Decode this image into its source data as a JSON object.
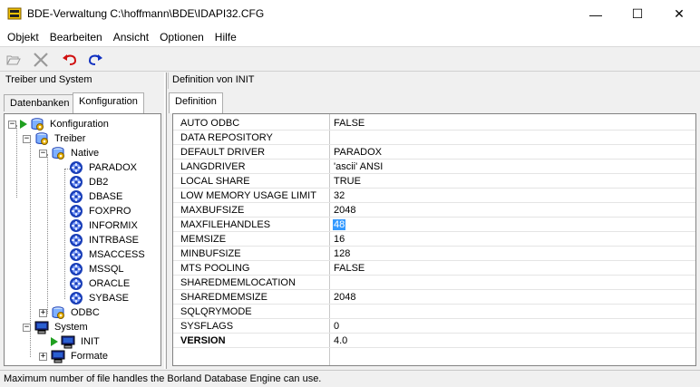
{
  "window": {
    "title": "BDE-Verwaltung  C:\\hoffmann\\BDE\\IDAPI32.CFG",
    "minimize_glyph": "—",
    "maximize_glyph": "☐",
    "close_glyph": "✕"
  },
  "menu": [
    {
      "label": "Objekt"
    },
    {
      "label": "Bearbeiten"
    },
    {
      "label": "Ansicht"
    },
    {
      "label": "Optionen"
    },
    {
      "label": "Hilfe"
    }
  ],
  "toolbar": {
    "icons": [
      "open-folder-icon",
      "delete-x-icon",
      "undo-icon",
      "redo-icon"
    ]
  },
  "left": {
    "header": "Treiber und System",
    "tabs": [
      "Datenbanken",
      "Konfiguration"
    ],
    "active_tab": "Konfiguration",
    "tree": [
      {
        "label": "Konfiguration",
        "exp": "−",
        "icon": "config-db-icon",
        "play": true
      },
      {
        "label": "Treiber",
        "exp": "−",
        "icon": "drivers-db-icon",
        "play": false
      },
      {
        "label": "Native",
        "exp": "−",
        "icon": "native-db-icon",
        "play": false
      },
      {
        "label": "PARADOX",
        "exp": "",
        "icon": "driver-icon",
        "play": false
      },
      {
        "label": "DB2",
        "exp": "",
        "icon": "driver-icon",
        "play": false
      },
      {
        "label": "DBASE",
        "exp": "",
        "icon": "driver-icon",
        "play": false
      },
      {
        "label": "FOXPRO",
        "exp": "",
        "icon": "driver-icon",
        "play": false
      },
      {
        "label": "INFORMIX",
        "exp": "",
        "icon": "driver-icon",
        "play": false
      },
      {
        "label": "INTRBASE",
        "exp": "",
        "icon": "driver-icon",
        "play": false
      },
      {
        "label": "MSACCESS",
        "exp": "",
        "icon": "driver-icon",
        "play": false
      },
      {
        "label": "MSSQL",
        "exp": "",
        "icon": "driver-icon",
        "play": false
      },
      {
        "label": "ORACLE",
        "exp": "",
        "icon": "driver-icon",
        "play": false
      },
      {
        "label": "SYBASE",
        "exp": "",
        "icon": "driver-icon",
        "play": false
      },
      {
        "label": "ODBC",
        "exp": "+",
        "icon": "odbc-db-icon",
        "play": false
      },
      {
        "label": "System",
        "exp": "−",
        "icon": "system-computer-icon",
        "play": false
      },
      {
        "label": "INIT",
        "exp": "",
        "icon": "init-computer-icon",
        "play": true
      },
      {
        "label": "Formate",
        "exp": "+",
        "icon": "formats-computer-icon",
        "play": false
      }
    ]
  },
  "right": {
    "header": "Definition von INIT",
    "tab": "Definition",
    "rows": [
      {
        "key": "AUTO ODBC",
        "value": "FALSE"
      },
      {
        "key": "DATA REPOSITORY",
        "value": ""
      },
      {
        "key": "DEFAULT DRIVER",
        "value": "PARADOX"
      },
      {
        "key": "LANGDRIVER",
        "value": "'ascii' ANSI"
      },
      {
        "key": "LOCAL SHARE",
        "value": "TRUE"
      },
      {
        "key": "LOW MEMORY USAGE LIMIT",
        "value": "32"
      },
      {
        "key": "MAXBUFSIZE",
        "value": "2048"
      },
      {
        "key": "MAXFILEHANDLES",
        "value": "48",
        "selected": true
      },
      {
        "key": "MEMSIZE",
        "value": "16"
      },
      {
        "key": "MINBUFSIZE",
        "value": "128"
      },
      {
        "key": "MTS POOLING",
        "value": "FALSE"
      },
      {
        "key": "SHAREDMEMLOCATION",
        "value": ""
      },
      {
        "key": "SHAREDMEMSIZE",
        "value": "2048"
      },
      {
        "key": "SQLQRYMODE",
        "value": ""
      },
      {
        "key": "SYSFLAGS",
        "value": "0"
      },
      {
        "key": "VERSION",
        "value": "4.0",
        "bold": true
      }
    ]
  },
  "status": "Maximum number of file handles the Borland Database Engine can use.",
  "colors": {
    "selection": "#3399ff",
    "play_green": "#20a020",
    "driver_blue": "#1a3fb8"
  }
}
